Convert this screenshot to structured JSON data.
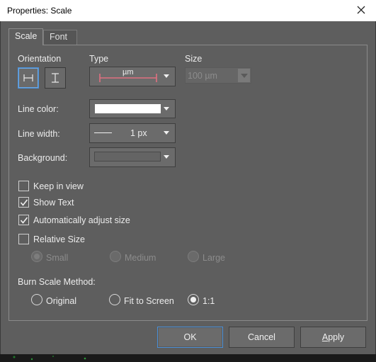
{
  "window": {
    "title": "Properties: Scale"
  },
  "tabs": [
    {
      "label": "Scale",
      "active": true
    },
    {
      "label": "Font",
      "active": false
    }
  ],
  "labels": {
    "orientation": "Orientation",
    "type": "Type",
    "size": "Size",
    "line_color": "Line color:",
    "line_width": "Line width:",
    "background": "Background:"
  },
  "type_combo": {
    "unit": "µm",
    "accent": "#e07080"
  },
  "size_combo": {
    "value": "100 µm",
    "enabled": false
  },
  "line_color_combo": {
    "color": "#ffffff"
  },
  "line_width_combo": {
    "value": "1 px"
  },
  "checkboxes": [
    {
      "label": "Keep in view",
      "checked": false
    },
    {
      "label": "Show Text",
      "checked": true
    },
    {
      "label": "Automatically adjust size",
      "checked": true
    },
    {
      "label": "Relative Size",
      "checked": false
    }
  ],
  "relative_size_options": [
    {
      "label": "Small",
      "selected": true,
      "enabled": false
    },
    {
      "label": "Medium",
      "selected": false,
      "enabled": false
    },
    {
      "label": "Large",
      "selected": false,
      "enabled": false
    }
  ],
  "burn_method": {
    "label": "Burn Scale Method:",
    "options": [
      {
        "label": "Original",
        "selected": false
      },
      {
        "label": "Fit to Screen",
        "selected": false
      },
      {
        "label": "1:1",
        "selected": true
      }
    ]
  },
  "buttons": {
    "ok": "OK",
    "cancel": "Cancel",
    "apply_prefix": "A",
    "apply_rest": "pply"
  },
  "icons": {
    "close": "close-icon",
    "horizontal": "horizontal-scale-icon",
    "vertical": "vertical-scale-icon",
    "check": "checkmark-icon",
    "dropdown": "chevron-down-icon"
  },
  "colors": {
    "accent_blue": "#4a8fd6",
    "panel": "#5e5e5e"
  }
}
